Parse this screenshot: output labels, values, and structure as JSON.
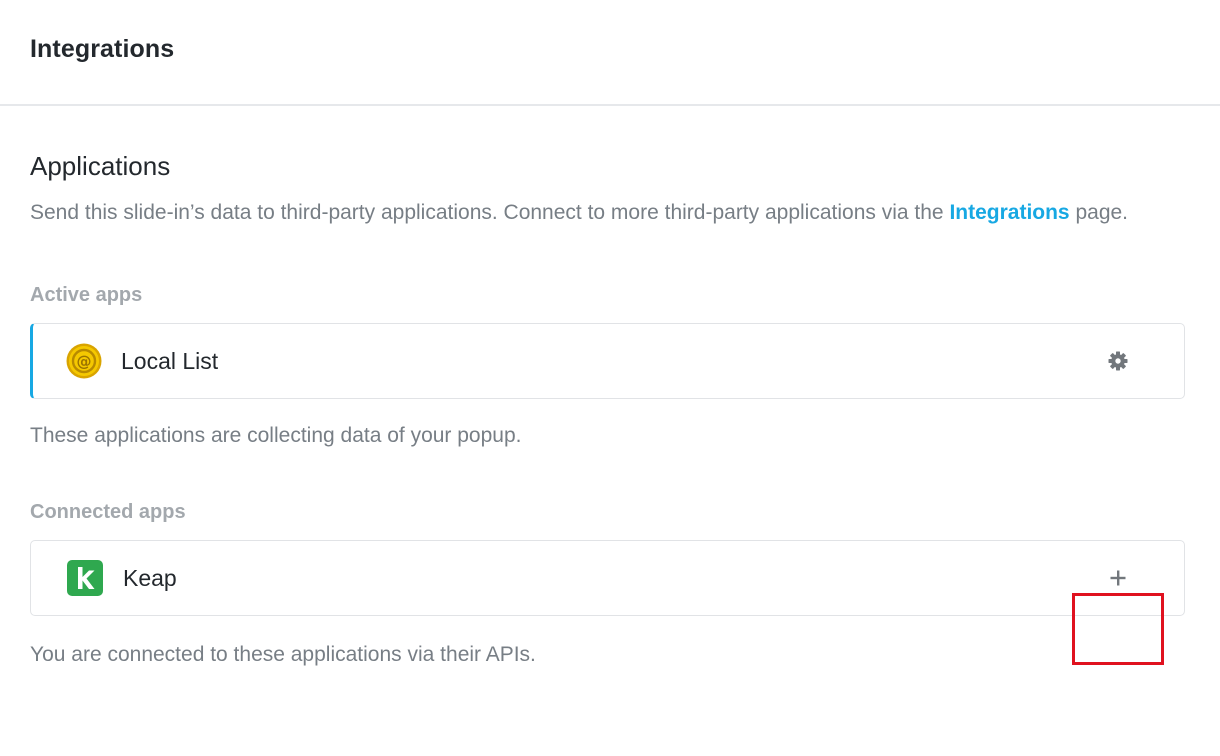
{
  "header": {
    "title": "Integrations"
  },
  "applications": {
    "title": "Applications",
    "description_before": "Send this slide-in’s data to third-party applications. Connect to more third-party applications via the ",
    "description_link": "Integrations",
    "description_after": " page."
  },
  "active_apps": {
    "label": "Active apps",
    "items": [
      {
        "name": "Local List",
        "icon": "local-list-icon",
        "action_icon": "gear-icon"
      }
    ],
    "helper": "These applications are collecting data of your popup."
  },
  "connected_apps": {
    "label": "Connected apps",
    "items": [
      {
        "name": "Keap",
        "icon": "keap-icon",
        "action_icon": "plus-icon"
      }
    ],
    "helper": "You are connected to these applications via their APIs."
  },
  "colors": {
    "accent": "#17a8e3",
    "highlight": "#e0111f",
    "keap_green": "#2fa84f",
    "local_list_gold": "#f2c200"
  }
}
